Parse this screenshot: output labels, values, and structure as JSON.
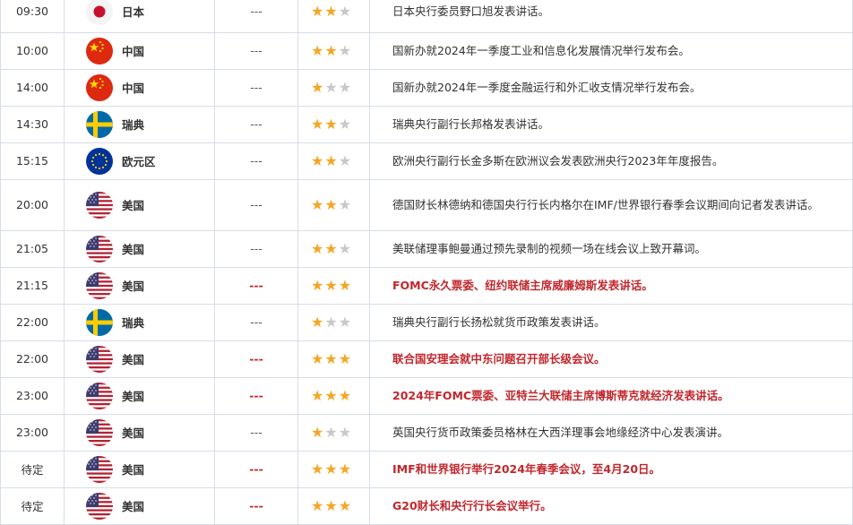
{
  "events": [
    {
      "time": "09:30",
      "country": "日本",
      "flag": "jp",
      "value": "---",
      "stars": 2,
      "important": false,
      "desc": "日本央行委员野口旭发表讲话。",
      "h": 46
    },
    {
      "time": "10:00",
      "country": "中国",
      "flag": "cn",
      "value": "---",
      "stars": 2,
      "important": false,
      "desc": "国新办就2024年一季度工业和信息化发展情况举行发布会。",
      "h": 41
    },
    {
      "time": "14:00",
      "country": "中国",
      "flag": "cn",
      "value": "---",
      "stars": 1,
      "important": false,
      "desc": "国新办就2024年一季度金融运行和外汇收支情况举行发布会。",
      "h": 41
    },
    {
      "time": "14:30",
      "country": "瑞典",
      "flag": "se",
      "value": "---",
      "stars": 2,
      "important": false,
      "desc": "瑞典央行副行长邦格发表讲话。",
      "h": 41
    },
    {
      "time": "15:15",
      "country": "欧元区",
      "flag": "eu",
      "value": "---",
      "stars": 2,
      "important": false,
      "desc": "欧洲央行副行长金多斯在欧洲议会发表欧洲央行2023年年度报告。",
      "h": 41
    },
    {
      "time": "20:00",
      "country": "美国",
      "flag": "us",
      "value": "---",
      "stars": 2,
      "important": false,
      "desc": "德国财长林德纳和德国央行行长内格尔在IMF/世界银行春季会议期间向记者发表讲话。",
      "h": 57
    },
    {
      "time": "21:05",
      "country": "美国",
      "flag": "us",
      "value": "---",
      "stars": 2,
      "important": false,
      "desc": "美联储理事鲍曼通过预先录制的视频一场在线会议上致开幕词。",
      "h": 41
    },
    {
      "time": "21:15",
      "country": "美国",
      "flag": "us",
      "value": "---",
      "stars": 3,
      "important": true,
      "desc": "FOMC永久票委、纽约联储主席威廉姆斯发表讲话。",
      "h": 41
    },
    {
      "time": "22:00",
      "country": "瑞典",
      "flag": "se",
      "value": "---",
      "stars": 1,
      "important": false,
      "desc": "瑞典央行副行长扬松就货币政策发表讲话。",
      "h": 41
    },
    {
      "time": "22:00",
      "country": "美国",
      "flag": "us",
      "value": "---",
      "stars": 3,
      "important": true,
      "desc": "联合国安理会就中东问题召开部长级会议。",
      "h": 41
    },
    {
      "time": "23:00",
      "country": "美国",
      "flag": "us",
      "value": "---",
      "stars": 3,
      "important": true,
      "desc": "2024年FOMC票委、亚特兰大联储主席博斯蒂克就经济发表讲话。",
      "h": 41
    },
    {
      "time": "23:00",
      "country": "美国",
      "flag": "us",
      "value": "---",
      "stars": 1,
      "important": false,
      "desc": "英国央行货币政策委员格林在大西洋理事会地缘经济中心发表演讲。",
      "h": 41
    },
    {
      "time": "待定",
      "country": "美国",
      "flag": "us",
      "value": "---",
      "stars": 3,
      "important": true,
      "desc": "IMF和世界银行举行2024年春季会议，至4月20日。",
      "h": 41
    },
    {
      "time": "待定",
      "country": "美国",
      "flag": "us",
      "value": "---",
      "stars": 3,
      "important": true,
      "desc": "G20财长和央行行长会议举行。",
      "h": 41
    }
  ],
  "colors": {
    "important": "#c1272d",
    "star_on": "#f5a623",
    "star_off": "#c8c8c8",
    "border": "#d7dde8"
  }
}
